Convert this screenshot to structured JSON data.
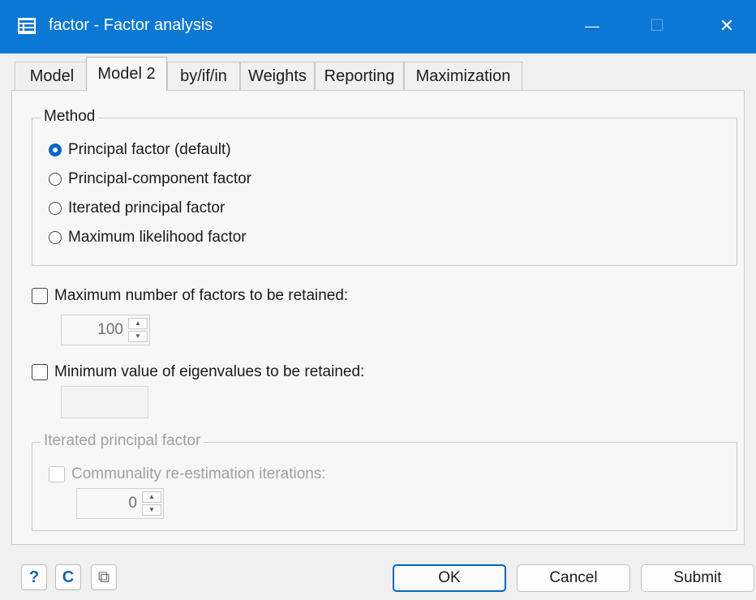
{
  "window": {
    "title": "factor - Factor analysis",
    "minimize": "—",
    "maximize": "☐",
    "close": "✕"
  },
  "tabs": [
    {
      "label": "Model",
      "active": false
    },
    {
      "label": "Model 2",
      "active": true
    },
    {
      "label": "by/if/in",
      "active": false
    },
    {
      "label": "Weights",
      "active": false
    },
    {
      "label": "Reporting",
      "active": false
    },
    {
      "label": "Maximization",
      "active": false
    }
  ],
  "method": {
    "legend": "Method",
    "options": [
      {
        "label": "Principal factor (default)",
        "selected": true
      },
      {
        "label": "Principal-component factor",
        "selected": false
      },
      {
        "label": "Iterated principal factor",
        "selected": false
      },
      {
        "label": "Maximum likelihood factor",
        "selected": false
      }
    ]
  },
  "max_factors": {
    "label": "Maximum number of factors to be retained:",
    "checked": false,
    "value": "100"
  },
  "min_eigen": {
    "label": "Minimum value of eigenvalues to be retained:",
    "checked": false,
    "value": ""
  },
  "iterated": {
    "legend": "Iterated principal factor",
    "check_label": "Communality re-estimation iterations:",
    "checked": false,
    "value": "0"
  },
  "footer": {
    "help": "?",
    "reset": "C",
    "copy": "⧉",
    "ok": "OK",
    "cancel": "Cancel",
    "submit": "Submit"
  },
  "colors": {
    "titlebar": "#0a78d4",
    "accent": "#0067c0"
  }
}
